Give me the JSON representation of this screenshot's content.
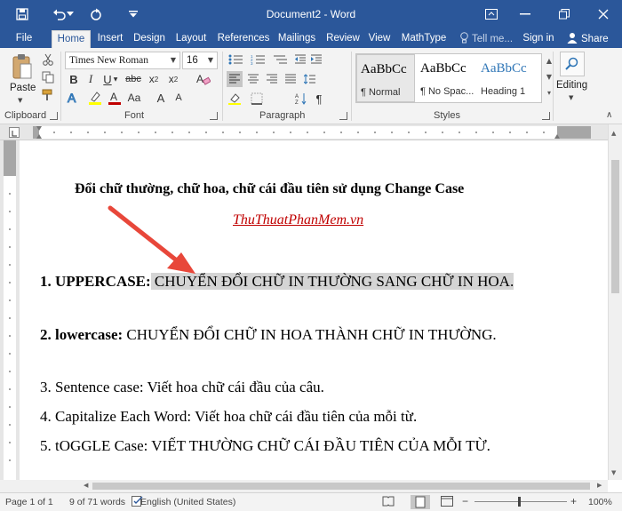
{
  "titlebar": {
    "title": "Document2 - Word",
    "qat": [
      "save-icon",
      "undo-icon",
      "redo-icon"
    ],
    "bg": "#2b579a"
  },
  "tabs": [
    {
      "label": "File"
    },
    {
      "label": "Home",
      "active": true
    },
    {
      "label": "Insert"
    },
    {
      "label": "Design"
    },
    {
      "label": "Layout"
    },
    {
      "label": "References"
    },
    {
      "label": "Mailings"
    },
    {
      "label": "Review"
    },
    {
      "label": "View"
    },
    {
      "label": "MathType"
    }
  ],
  "tell_me": "Tell me...",
  "sign_in": "Sign in",
  "share": "Share",
  "ribbon": {
    "clipboard": {
      "label": "Clipboard",
      "paste": "Paste"
    },
    "font": {
      "label": "Font",
      "name": "Times New Roman",
      "size": "16"
    },
    "paragraph": {
      "label": "Paragraph"
    },
    "styles": {
      "label": "Styles",
      "items": [
        {
          "preview": "AaBbCc",
          "name": "¶ Normal"
        },
        {
          "preview": "AaBbCc",
          "name": "¶ No Spac..."
        },
        {
          "preview": "AaBbCc",
          "name": "Heading 1"
        }
      ]
    },
    "editing": {
      "label": "Editing"
    }
  },
  "document": {
    "title": "Đổi chữ thường, chữ hoa, chữ cái đầu tiên sử dụng Change Case",
    "link": "ThuThuatPhanMem.vn",
    "items": [
      {
        "label": "1. UPPERCASE:",
        "text": " CHUYỂN ĐỔI CHỮ IN THƯỜNG SANG CHỮ IN HOA."
      },
      {
        "label": "2. lowercase:",
        "text": " CHUYỂN ĐỔI CHỮ IN HOA THÀNH CHỮ IN THƯỜNG."
      },
      {
        "text": "3. Sentence case: Viết hoa chữ cái đầu của câu."
      },
      {
        "text": "4. Capitalize Each Word: Viết hoa chữ cái đầu tiên của mỗi từ."
      },
      {
        "text": "5. tOGGLE Case: VIẾT THƯỜNG CHỮ CÁI ĐẦU TIÊN CỦA MỖI TỪ."
      }
    ],
    "arrow_color": "#e8473a",
    "highlight_color": "#d4d4d4"
  },
  "status": {
    "page": "Page 1 of 1",
    "words": "9 of 71 words",
    "language": "English (United States)",
    "zoom": "100%"
  }
}
